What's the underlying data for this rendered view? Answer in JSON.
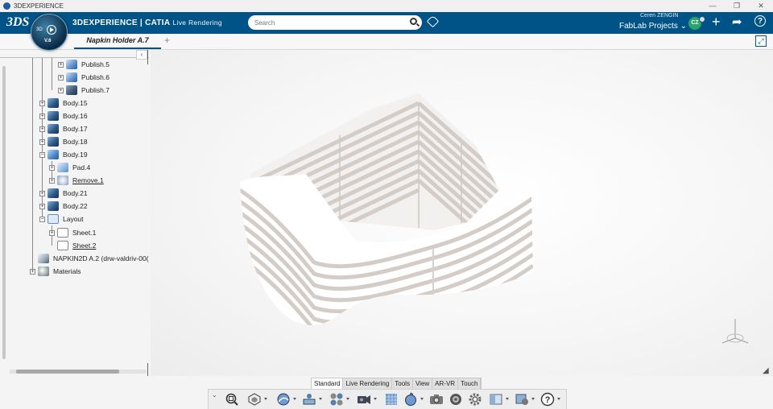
{
  "window": {
    "title": "3DEXPERIENCE",
    "controls": [
      "—",
      "❐",
      "✕"
    ]
  },
  "topbar": {
    "logo": "3DS",
    "brand_main": "3DEXPERIENCE | CATIA",
    "brand_app": "Live Rendering",
    "compass_label": "3D",
    "compass_version": "V.6",
    "search_placeholder": "Search",
    "user_name": "Ceren ZENGIN",
    "workspace": "FabLab Projects",
    "avatar_initials": "CZ",
    "brand_color": "#005386"
  },
  "tabs": {
    "active_label": "Napkin Holder A.7",
    "add_label": "+"
  },
  "tree": {
    "collapse_label": "‹",
    "items": [
      {
        "label": "Publish.5",
        "icon": "publish-icon",
        "underline": false
      },
      {
        "label": "Publish.6",
        "icon": "publish-icon",
        "underline": false
      },
      {
        "label": "Publish.7",
        "icon": "publish-dark-icon",
        "underline": false
      },
      {
        "label": "Body.15",
        "icon": "body-icon",
        "underline": false
      },
      {
        "label": "Body.16",
        "icon": "body-icon",
        "underline": false
      },
      {
        "label": "Body.17",
        "icon": "body-icon",
        "underline": false
      },
      {
        "label": "Body.18",
        "icon": "body-icon",
        "underline": false
      },
      {
        "label": "Body.19",
        "icon": "body-open-icon",
        "underline": false
      },
      {
        "label": "Pad.4",
        "icon": "pad-icon",
        "underline": false
      },
      {
        "label": "Remove.1",
        "icon": "remove-icon",
        "underline": true
      },
      {
        "label": "Body.21",
        "icon": "body-icon",
        "underline": false
      },
      {
        "label": "Body.22",
        "icon": "body-icon",
        "underline": false
      },
      {
        "label": "Layout",
        "icon": "layout-icon",
        "underline": false
      },
      {
        "label": "Sheet.1",
        "icon": "sheet-icon",
        "underline": false
      },
      {
        "label": "Sheet.2",
        "icon": "sheet-icon",
        "underline": true
      },
      {
        "label": "NAPKIN2D A.2 (drw-valdriv-00(",
        "icon": "drawing-icon",
        "underline": false
      },
      {
        "label": "Materials",
        "icon": "materials-icon",
        "underline": false
      }
    ]
  },
  "action_bar": {
    "tabs": [
      "Standard",
      "Live Rendering",
      "Tools",
      "View",
      "AR-VR",
      "Touch"
    ],
    "active_tab": "Standard",
    "tools": [
      "zoom-fit-icon",
      "render-style-icon",
      "ambiance-icon",
      "light-icon",
      "material-icon",
      "camera-icon",
      "floor-icon",
      "animation-icon",
      "capture-icon",
      "render-icon",
      "settings-icon",
      "layout-icon",
      "options-icon",
      "help-icon"
    ]
  }
}
